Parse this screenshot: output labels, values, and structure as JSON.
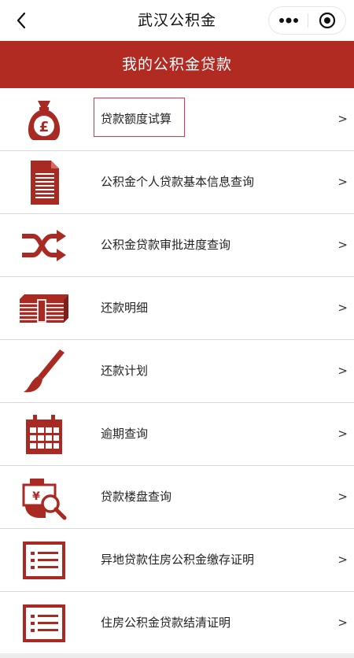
{
  "nav": {
    "title": "武汉公积金",
    "back_icon": "chevron-left-icon",
    "more_icon": "more-dots-icon",
    "close_icon": "target-circle-icon"
  },
  "banner": {
    "title": "我的公积金贷款"
  },
  "colors": {
    "brand_red": "#b22b22",
    "icon_red": "#a82a22",
    "highlight": "#e0344a"
  },
  "items": [
    {
      "label": "贷款额度试算",
      "arrow": ">",
      "icon": "money-bag-icon"
    },
    {
      "label": "公积金个人贷款基本信息查询",
      "arrow": ">",
      "icon": "document-icon"
    },
    {
      "label": "公积金贷款审批进度查询",
      "arrow": ">",
      "icon": "shuffle-icon"
    },
    {
      "label": "还款明细",
      "arrow": ">",
      "icon": "cash-stack-icon"
    },
    {
      "label": "还款计划",
      "arrow": ">",
      "icon": "brush-icon"
    },
    {
      "label": "逾期查询",
      "arrow": ">",
      "icon": "calendar-icon"
    },
    {
      "label": "贷款楼盘查询",
      "arrow": ">",
      "icon": "hand-search-icon"
    },
    {
      "label": "异地贷款住房公积金缴存证明",
      "arrow": ">",
      "icon": "list-doc-icon"
    },
    {
      "label": "住房公积金贷款结清证明",
      "arrow": ">",
      "icon": "list-doc-icon"
    }
  ]
}
